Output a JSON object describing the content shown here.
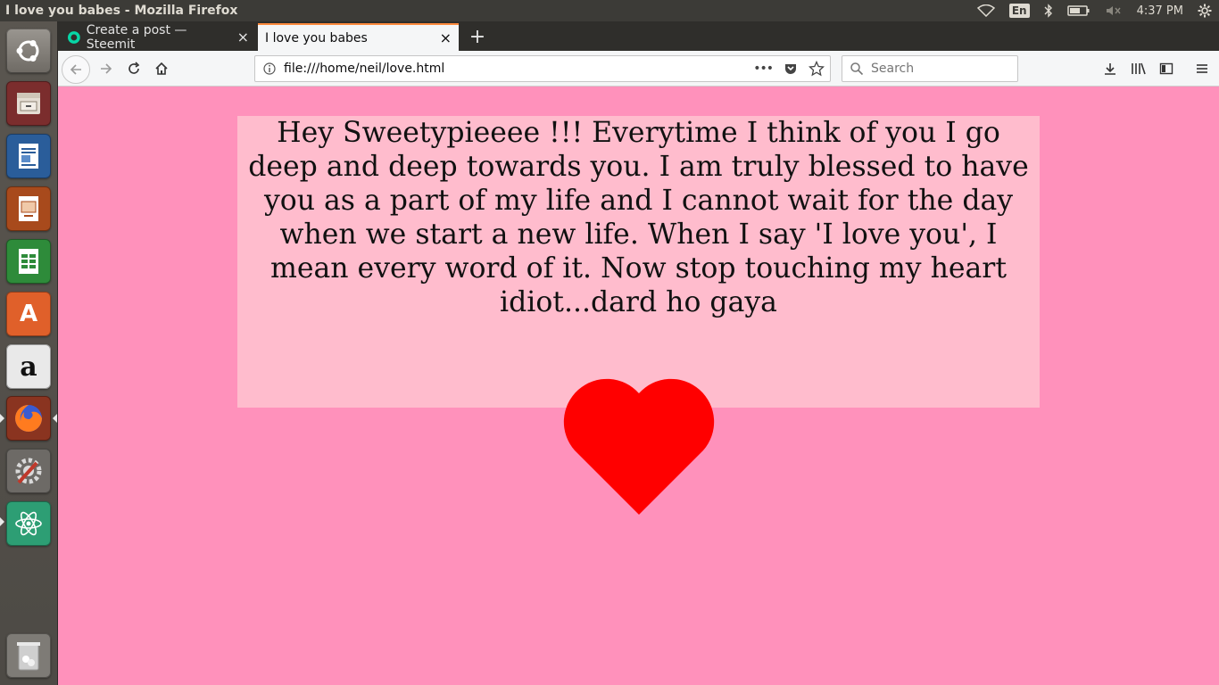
{
  "system": {
    "window_title": "I love you babes - Mozilla Firefox",
    "keyboard_lang": "En",
    "clock": "4:37 PM",
    "tray_icons": [
      "wifi-icon",
      "keyboard-language",
      "bluetooth-icon",
      "battery-icon",
      "volume-muted-icon",
      "clock",
      "settings-gear-icon"
    ]
  },
  "launcher": {
    "items": [
      {
        "name": "ubuntu-dash",
        "icon": "ubuntu-logo-icon"
      },
      {
        "name": "files",
        "icon": "file-cabinet-icon"
      },
      {
        "name": "libreoffice-writer",
        "icon": "writer-document-icon"
      },
      {
        "name": "libreoffice-impress",
        "icon": "impress-presentation-icon"
      },
      {
        "name": "libreoffice-calc",
        "icon": "calc-spreadsheet-icon"
      },
      {
        "name": "ubuntu-software",
        "icon": "software-bag-icon",
        "glyph": "A"
      },
      {
        "name": "amazon",
        "icon": "amazon-icon",
        "glyph": "a"
      },
      {
        "name": "firefox",
        "icon": "firefox-icon"
      },
      {
        "name": "system-settings",
        "icon": "settings-tools-icon"
      },
      {
        "name": "atom",
        "icon": "atom-icon"
      },
      {
        "name": "trash",
        "icon": "trash-icon"
      }
    ]
  },
  "browser": {
    "tabs": [
      {
        "label": "Create a post — Steemit",
        "active": false,
        "close": "×"
      },
      {
        "label": "I love you babes",
        "active": true,
        "close": "×"
      }
    ],
    "new_tab": "+",
    "url": "file:///home/neil/love.html",
    "page_actions": "•••",
    "search_placeholder": "Search"
  },
  "page": {
    "message": "Hey Sweetypieeee !!! Everytime I think of you I go deep and deep towards you. I am truly blessed to have you as a part of my life and I cannot wait for the day when we start a new life. When I say 'I love you', I mean every word of it. Now stop touching my heart idiot...dard ho gaya",
    "heart_color": "#ff0000",
    "page_bg": "#ff91bb",
    "box_bg": "#ffbccd"
  }
}
